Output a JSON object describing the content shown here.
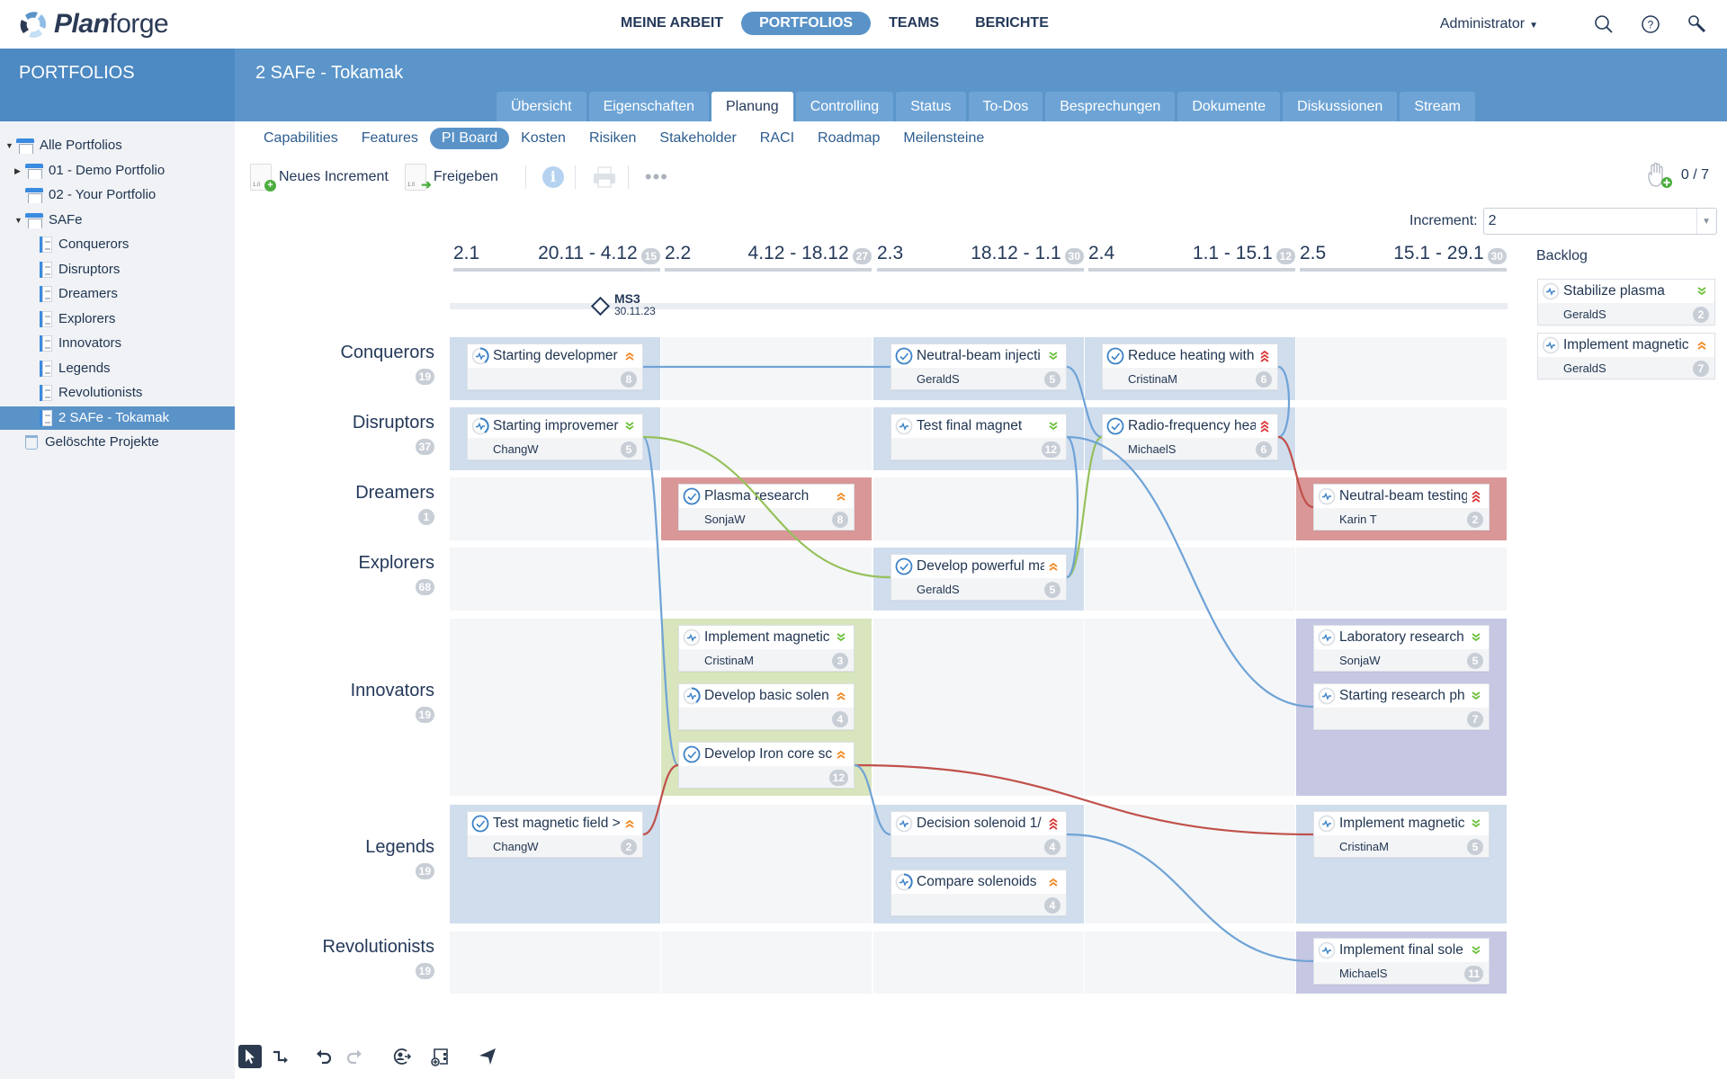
{
  "app": {
    "name_bold": "Plan",
    "name_rest": "forge"
  },
  "mainnav": [
    {
      "label": "MEINE ARBEIT",
      "active": false
    },
    {
      "label": "PORTFOLIOS",
      "active": true
    },
    {
      "label": "TEAMS",
      "active": false
    },
    {
      "label": "BERICHTE",
      "active": false
    }
  ],
  "user": {
    "name": "Administrator"
  },
  "sidebar": {
    "title": "PORTFOLIOS",
    "items": [
      {
        "label": "Alle Portfolios",
        "icon": "folder-icon",
        "toggle": "expanded",
        "indent": 0
      },
      {
        "label": "01 - Demo Portfolio",
        "icon": "folder-icon",
        "toggle": "collapsed",
        "indent": 1
      },
      {
        "label": "02 - Your Portfolio",
        "icon": "folder-icon",
        "toggle": "none",
        "indent": 1
      },
      {
        "label": "SAFe",
        "icon": "folder-icon",
        "toggle": "expanded",
        "indent": 1
      },
      {
        "label": "Conquerors",
        "icon": "team-icon",
        "toggle": "none",
        "indent": 2
      },
      {
        "label": "Disruptors",
        "icon": "team-icon",
        "toggle": "none",
        "indent": 2
      },
      {
        "label": "Dreamers",
        "icon": "team-icon",
        "toggle": "none",
        "indent": 2
      },
      {
        "label": "Explorers",
        "icon": "team-icon",
        "toggle": "none",
        "indent": 2
      },
      {
        "label": "Innovators",
        "icon": "team-icon",
        "toggle": "none",
        "indent": 2
      },
      {
        "label": "Legends",
        "icon": "team-icon",
        "toggle": "none",
        "indent": 2
      },
      {
        "label": "Revolutionists",
        "icon": "team-icon",
        "toggle": "none",
        "indent": 2
      },
      {
        "label": "2 SAFe - Tokamak",
        "icon": "project-icon",
        "toggle": "none",
        "indent": 2,
        "selected": true
      },
      {
        "label": "Gelöschte Projekte",
        "icon": "trash-icon",
        "toggle": "none",
        "indent": 1
      }
    ]
  },
  "project": {
    "title": "2 SAFe - Tokamak"
  },
  "tabs": [
    {
      "label": "Übersicht"
    },
    {
      "label": "Eigenschaften"
    },
    {
      "label": "Planung",
      "active": true
    },
    {
      "label": "Controlling"
    },
    {
      "label": "Status"
    },
    {
      "label": "To-Dos"
    },
    {
      "label": "Besprechungen"
    },
    {
      "label": "Dokumente"
    },
    {
      "label": "Diskussionen"
    },
    {
      "label": "Stream"
    }
  ],
  "subtabs": [
    {
      "label": "Capabilities"
    },
    {
      "label": "Features"
    },
    {
      "label": "PI Board",
      "active": true
    },
    {
      "label": "Kosten"
    },
    {
      "label": "Risiken"
    },
    {
      "label": "Stakeholder"
    },
    {
      "label": "RACI"
    },
    {
      "label": "Roadmap"
    },
    {
      "label": "Meilensteine"
    }
  ],
  "toolbar": {
    "new_increment": "Neues Increment",
    "new_increment_icon_label": "1.0",
    "release": "Freigeben",
    "release_icon_label": "1.0"
  },
  "capacity": {
    "value": "0 / 7"
  },
  "increment": {
    "label": "Increment:",
    "value": "2"
  },
  "iterations": [
    {
      "id": "2.1",
      "range": "20.11 - 4.12",
      "count": "15"
    },
    {
      "id": "2.2",
      "range": "4.12 - 18.12",
      "count": "27"
    },
    {
      "id": "2.3",
      "range": "18.12 - 1.1",
      "count": "30"
    },
    {
      "id": "2.4",
      "range": "1.1 - 15.1",
      "count": "12"
    },
    {
      "id": "2.5",
      "range": "15.1 - 29.1",
      "count": "30"
    }
  ],
  "milestone": {
    "name": "MS3",
    "date": "30.11.23"
  },
  "lanes": [
    {
      "name": "Conquerors",
      "count": "19"
    },
    {
      "name": "Disruptors",
      "count": "37"
    },
    {
      "name": "Dreamers",
      "count": "1"
    },
    {
      "name": "Explorers",
      "count": "68"
    },
    {
      "name": "Innovators",
      "count": "19"
    },
    {
      "name": "Legends",
      "count": "19"
    },
    {
      "name": "Revolutionists",
      "count": "19"
    }
  ],
  "cards": [
    {
      "id": "c1",
      "lane": 0,
      "col": 0,
      "slot": 0,
      "title": "Starting developmer",
      "owner": "",
      "points": "8",
      "status": "in-progress",
      "priority": "high"
    },
    {
      "id": "c2",
      "lane": 0,
      "col": 2,
      "slot": 0,
      "title": "Neutral-beam injecti",
      "owner": "GeraldS",
      "points": "5",
      "status": "done",
      "priority": "low"
    },
    {
      "id": "c3",
      "lane": 0,
      "col": 3,
      "slot": 0,
      "title": "Reduce heating with",
      "owner": "CristinaM",
      "points": "6",
      "status": "done",
      "priority": "critical"
    },
    {
      "id": "c4",
      "lane": 1,
      "col": 0,
      "slot": 0,
      "title": "Starting improvemer",
      "owner": "ChangW",
      "points": "5",
      "status": "in-progress",
      "priority": "low"
    },
    {
      "id": "c5",
      "lane": 1,
      "col": 2,
      "slot": 0,
      "title": "Test final magnet",
      "owner": "",
      "points": "12",
      "status": "open",
      "priority": "low"
    },
    {
      "id": "c6",
      "lane": 1,
      "col": 3,
      "slot": 0,
      "title": "Radio-frequency hea",
      "owner": "MichaelS",
      "points": "6",
      "status": "done",
      "priority": "critical"
    },
    {
      "id": "c7",
      "lane": 2,
      "col": 1,
      "slot": 0,
      "title": "Plasma research",
      "owner": "SonjaW",
      "points": "8",
      "status": "done",
      "priority": "high"
    },
    {
      "id": "c8",
      "lane": 2,
      "col": 4,
      "slot": 0,
      "title": "Neutral-beam testing",
      "owner": "Karin T",
      "points": "2",
      "status": "open",
      "priority": "critical"
    },
    {
      "id": "c9",
      "lane": 3,
      "col": 2,
      "slot": 0,
      "title": "Develop powerful ma",
      "owner": "GeraldS",
      "points": "5",
      "status": "done",
      "priority": "high"
    },
    {
      "id": "c10",
      "lane": 4,
      "col": 1,
      "slot": 0,
      "title": "Implement magnetic",
      "owner": "CristinaM",
      "points": "3",
      "status": "open",
      "priority": "low"
    },
    {
      "id": "c11",
      "lane": 4,
      "col": 1,
      "slot": 1,
      "title": "Develop basic solen",
      "owner": "",
      "points": "4",
      "status": "in-progress",
      "priority": "high"
    },
    {
      "id": "c12",
      "lane": 4,
      "col": 1,
      "slot": 2,
      "title": "Develop Iron core sc",
      "owner": "",
      "points": "12",
      "status": "done",
      "priority": "high"
    },
    {
      "id": "c13",
      "lane": 4,
      "col": 4,
      "slot": 0,
      "title": "Laboratory research",
      "owner": "SonjaW",
      "points": "5",
      "status": "open",
      "priority": "low"
    },
    {
      "id": "c14",
      "lane": 4,
      "col": 4,
      "slot": 1,
      "title": "Starting research ph",
      "owner": "",
      "points": "7",
      "status": "open",
      "priority": "low"
    },
    {
      "id": "c15",
      "lane": 5,
      "col": 0,
      "slot": 0,
      "title": "Test magnetic field >",
      "owner": "ChangW",
      "points": "2",
      "status": "done",
      "priority": "high"
    },
    {
      "id": "c16",
      "lane": 5,
      "col": 2,
      "slot": 0,
      "title": "Decision solenoid 1/",
      "owner": "",
      "points": "4",
      "status": "open",
      "priority": "critical"
    },
    {
      "id": "c17",
      "lane": 5,
      "col": 2,
      "slot": 1,
      "title": "Compare solenoids",
      "owner": "",
      "points": "4",
      "status": "in-progress",
      "priority": "high"
    },
    {
      "id": "c18",
      "lane": 5,
      "col": 4,
      "slot": 0,
      "title": "Implement magnetic",
      "owner": "CristinaM",
      "points": "5",
      "status": "open",
      "priority": "low"
    },
    {
      "id": "c19",
      "lane": 6,
      "col": 4,
      "slot": 0,
      "title": "Implement final sole",
      "owner": "MichaelS",
      "points": "11",
      "status": "open",
      "priority": "low"
    }
  ],
  "cell_colors": [
    {
      "lane": 0,
      "col": 0,
      "color": "blue"
    },
    {
      "lane": 0,
      "col": 2,
      "color": "blue"
    },
    {
      "lane": 0,
      "col": 3,
      "color": "blue"
    },
    {
      "lane": 1,
      "col": 0,
      "color": "blue"
    },
    {
      "lane": 1,
      "col": 2,
      "color": "blue"
    },
    {
      "lane": 1,
      "col": 3,
      "color": "blue"
    },
    {
      "lane": 2,
      "col": 1,
      "color": "red"
    },
    {
      "lane": 2,
      "col": 4,
      "color": "red"
    },
    {
      "lane": 3,
      "col": 2,
      "color": "blue"
    },
    {
      "lane": 4,
      "col": 1,
      "color": "green"
    },
    {
      "lane": 4,
      "col": 4,
      "color": "purple"
    },
    {
      "lane": 5,
      "col": 0,
      "color": "blue"
    },
    {
      "lane": 5,
      "col": 2,
      "color": "blue"
    },
    {
      "lane": 5,
      "col": 4,
      "color": "blue"
    },
    {
      "lane": 6,
      "col": 4,
      "color": "purple"
    }
  ],
  "dependencies": [
    {
      "from": "c1",
      "to": "c2",
      "color": "blue"
    },
    {
      "from": "c2",
      "to": "c6",
      "color": "blue"
    },
    {
      "from": "c4",
      "to": "c12",
      "color": "blue"
    },
    {
      "from": "c4",
      "to": "c9",
      "color": "green"
    },
    {
      "from": "c9",
      "to": "c6",
      "color": "green"
    },
    {
      "from": "c5",
      "to": "c9",
      "color": "blue"
    },
    {
      "from": "c5",
      "to": "c14",
      "color": "blue"
    },
    {
      "from": "c3",
      "to": "c6",
      "color": "blue"
    },
    {
      "from": "c6",
      "to": "c8",
      "color": "red"
    },
    {
      "from": "c15",
      "to": "c12",
      "color": "red"
    },
    {
      "from": "c12",
      "to": "c18",
      "color": "red"
    },
    {
      "from": "c12",
      "to": "c16",
      "color": "blue"
    },
    {
      "from": "c16",
      "to": "c19",
      "color": "blue"
    }
  ],
  "backlog": {
    "title": "Backlog",
    "items": [
      {
        "title": "Stabilize plasma",
        "owner": "GeraldS",
        "points": "2",
        "status": "open",
        "priority": "low"
      },
      {
        "title": "Implement magnetic",
        "owner": "GeraldS",
        "points": "7",
        "status": "open",
        "priority": "high"
      }
    ]
  },
  "colors": {
    "accent": "#5a93c8",
    "prio_low": "#6cbf3a",
    "prio_high": "#f08a24",
    "prio_critical": "#d9383a",
    "dep_blue": "#6fa3d6",
    "dep_green": "#95c15a",
    "dep_red": "#c0504a"
  },
  "bottom_tools": [
    "pointer-tool",
    "connector-tool",
    "undo",
    "redo",
    "reassign",
    "add-column",
    "send"
  ]
}
